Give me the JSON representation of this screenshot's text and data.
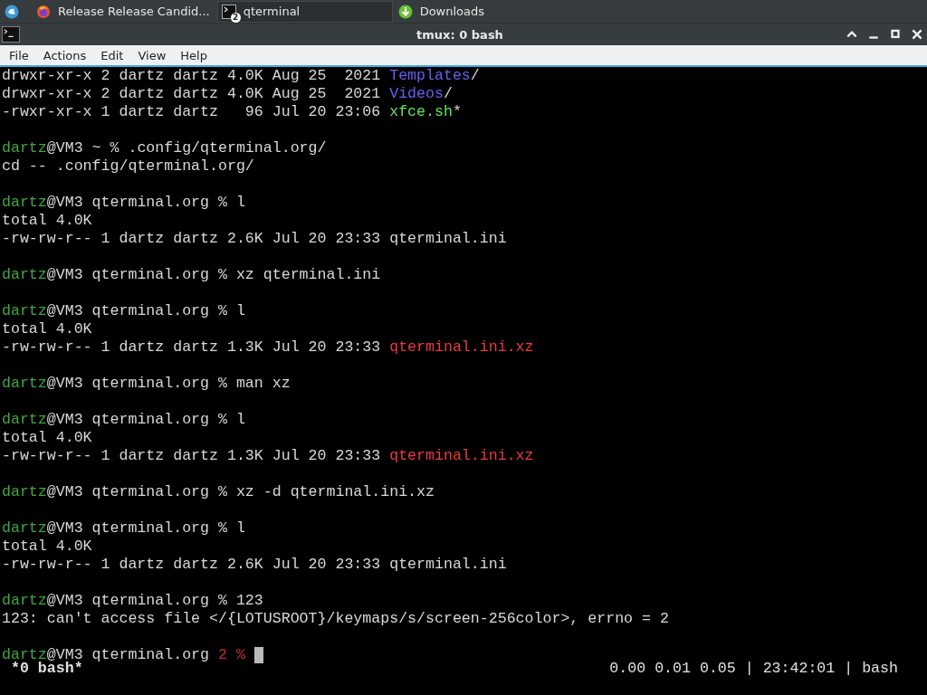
{
  "taskbar": {
    "tasks": [
      {
        "kind": "browser",
        "label": "Release Release Candid...",
        "selected": false
      },
      {
        "kind": "terminal",
        "label": "qterminal",
        "badge": "2",
        "selected": true
      },
      {
        "kind": "downloads",
        "label": "Downloads",
        "selected": false
      }
    ]
  },
  "window": {
    "title": "tmux: 0 bash"
  },
  "menu": [
    "File",
    "Actions",
    "Edit",
    "View",
    "Help"
  ],
  "terminal": {
    "lines": [
      {
        "kind": "text",
        "segments": [
          {
            "text": "drwxr-xr-x 2 dartz dartz 4.0K Aug 25  2021 ",
            "kind": "plain"
          },
          {
            "text": "Templates",
            "kind": "dir"
          },
          {
            "text": "/",
            "kind": "plain"
          }
        ]
      },
      {
        "kind": "text",
        "segments": [
          {
            "text": "drwxr-xr-x 2 dartz dartz 4.0K Aug 25  2021 ",
            "kind": "plain"
          },
          {
            "text": "Videos",
            "kind": "dir"
          },
          {
            "text": "/",
            "kind": "plain"
          }
        ]
      },
      {
        "kind": "text",
        "segments": [
          {
            "text": "-rwxr-xr-x 1 dartz dartz   96 Jul 20 23:06 ",
            "kind": "plain"
          },
          {
            "text": "xfce.sh",
            "kind": "exec"
          },
          {
            "text": "*",
            "kind": "plain"
          }
        ]
      },
      {
        "kind": "blank"
      },
      {
        "kind": "text",
        "segments": [
          {
            "text": "dartz",
            "kind": "user"
          },
          {
            "text": "@VM3 ~ % .config/qterminal.org/",
            "kind": "plain"
          }
        ]
      },
      {
        "kind": "text",
        "segments": [
          {
            "text": "cd -- .config/qterminal.org/",
            "kind": "plain"
          }
        ]
      },
      {
        "kind": "blank"
      },
      {
        "kind": "text",
        "segments": [
          {
            "text": "dartz",
            "kind": "user"
          },
          {
            "text": "@VM3 qterminal.org % l",
            "kind": "plain"
          }
        ]
      },
      {
        "kind": "text",
        "segments": [
          {
            "text": "total 4.0K",
            "kind": "plain"
          }
        ]
      },
      {
        "kind": "text",
        "segments": [
          {
            "text": "-rw-rw-r-- 1 dartz dartz 2.6K Jul 20 23:33 qterminal.ini",
            "kind": "plain"
          }
        ]
      },
      {
        "kind": "blank"
      },
      {
        "kind": "text",
        "segments": [
          {
            "text": "dartz",
            "kind": "user"
          },
          {
            "text": "@VM3 qterminal.org % xz qterminal.ini",
            "kind": "plain"
          }
        ]
      },
      {
        "kind": "blank"
      },
      {
        "kind": "text",
        "segments": [
          {
            "text": "dartz",
            "kind": "user"
          },
          {
            "text": "@VM3 qterminal.org % l",
            "kind": "plain"
          }
        ]
      },
      {
        "kind": "text",
        "segments": [
          {
            "text": "total 4.0K",
            "kind": "plain"
          }
        ]
      },
      {
        "kind": "text",
        "segments": [
          {
            "text": "-rw-rw-r-- 1 dartz dartz 1.3K Jul 20 23:33 ",
            "kind": "plain"
          },
          {
            "text": "qterminal.ini.xz",
            "kind": "archive"
          }
        ]
      },
      {
        "kind": "blank"
      },
      {
        "kind": "text",
        "segments": [
          {
            "text": "dartz",
            "kind": "user"
          },
          {
            "text": "@VM3 qterminal.org % man xz",
            "kind": "plain"
          }
        ]
      },
      {
        "kind": "blank"
      },
      {
        "kind": "text",
        "segments": [
          {
            "text": "dartz",
            "kind": "user"
          },
          {
            "text": "@VM3 qterminal.org % l",
            "kind": "plain"
          }
        ]
      },
      {
        "kind": "text",
        "segments": [
          {
            "text": "total 4.0K",
            "kind": "plain"
          }
        ]
      },
      {
        "kind": "text",
        "segments": [
          {
            "text": "-rw-rw-r-- 1 dartz dartz 1.3K Jul 20 23:33 ",
            "kind": "plain"
          },
          {
            "text": "qterminal.ini.xz",
            "kind": "archive"
          }
        ]
      },
      {
        "kind": "blank"
      },
      {
        "kind": "text",
        "segments": [
          {
            "text": "dartz",
            "kind": "user"
          },
          {
            "text": "@VM3 qterminal.org % xz -d qterminal.ini.xz",
            "kind": "plain"
          }
        ]
      },
      {
        "kind": "blank"
      },
      {
        "kind": "text",
        "segments": [
          {
            "text": "dartz",
            "kind": "user"
          },
          {
            "text": "@VM3 qterminal.org % l",
            "kind": "plain"
          }
        ]
      },
      {
        "kind": "text",
        "segments": [
          {
            "text": "total 4.0K",
            "kind": "plain"
          }
        ]
      },
      {
        "kind": "text",
        "segments": [
          {
            "text": "-rw-rw-r-- 1 dartz dartz 2.6K Jul 20 23:33 qterminal.ini",
            "kind": "plain"
          }
        ]
      },
      {
        "kind": "blank"
      },
      {
        "kind": "text",
        "segments": [
          {
            "text": "dartz",
            "kind": "user"
          },
          {
            "text": "@VM3 qterminal.org % 123",
            "kind": "plain"
          }
        ]
      },
      {
        "kind": "text",
        "segments": [
          {
            "text": "123: can't access file </{LOTUSROOT}/keymaps/s/screen-256color>, errno = 2",
            "kind": "plain"
          }
        ]
      },
      {
        "kind": "blank"
      },
      {
        "kind": "text",
        "segments": [
          {
            "text": "dartz",
            "kind": "user"
          },
          {
            "text": "@VM3 qterminal.org ",
            "kind": "plain"
          },
          {
            "text": "2 %",
            "kind": "error"
          }
        ],
        "cursor": true
      }
    ]
  },
  "tmux_status": {
    "window": "*0 bash*",
    "info": "0.00 0.01 0.05 | 23:42:01 | bash"
  }
}
